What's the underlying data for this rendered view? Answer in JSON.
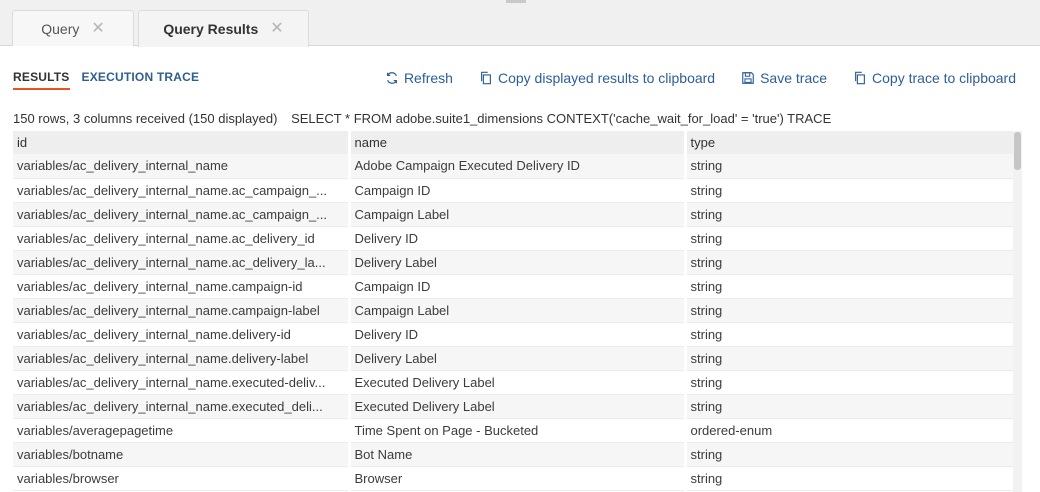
{
  "tabs": [
    {
      "label": "Query",
      "close": "✕"
    },
    {
      "label": "Query Results",
      "close": "✕"
    }
  ],
  "subtabs": [
    "RESULTS",
    "EXECUTION TRACE"
  ],
  "toolbar": {
    "refresh": "Refresh",
    "copy_results": "Copy displayed results to clipboard",
    "save_trace": "Save trace",
    "copy_trace": "Copy trace to clipboard"
  },
  "status": {
    "summary": "150 rows, 3 columns received (150 displayed)",
    "query": "SELECT * FROM adobe.suite1_dimensions CONTEXT('cache_wait_for_load' = 'true') TRACE"
  },
  "table": {
    "columns": [
      "id",
      "name",
      "type"
    ],
    "rows": [
      [
        "variables/ac_delivery_internal_name",
        "Adobe Campaign Executed Delivery ID",
        "string"
      ],
      [
        "variables/ac_delivery_internal_name.ac_campaign_...",
        "Campaign ID",
        "string"
      ],
      [
        "variables/ac_delivery_internal_name.ac_campaign_...",
        "Campaign Label",
        "string"
      ],
      [
        "variables/ac_delivery_internal_name.ac_delivery_id",
        "Delivery ID",
        "string"
      ],
      [
        "variables/ac_delivery_internal_name.ac_delivery_la...",
        "Delivery Label",
        "string"
      ],
      [
        "variables/ac_delivery_internal_name.campaign-id",
        "Campaign ID",
        "string"
      ],
      [
        "variables/ac_delivery_internal_name.campaign-label",
        "Campaign Label",
        "string"
      ],
      [
        "variables/ac_delivery_internal_name.delivery-id",
        "Delivery ID",
        "string"
      ],
      [
        "variables/ac_delivery_internal_name.delivery-label",
        "Delivery Label",
        "string"
      ],
      [
        "variables/ac_delivery_internal_name.executed-deliv...",
        "Executed Delivery Label",
        "string"
      ],
      [
        "variables/ac_delivery_internal_name.executed_deli...",
        "Executed Delivery Label",
        "string"
      ],
      [
        "variables/averagepagetime",
        "Time Spent on Page - Bucketed",
        "ordered-enum"
      ],
      [
        "variables/botname",
        "Bot Name",
        "string"
      ],
      [
        "variables/browser",
        "Browser",
        "string"
      ]
    ]
  },
  "colors": {
    "accent": "#e8541e",
    "link": "#2c5e99"
  },
  "icons": {
    "refresh": "refresh-icon",
    "copy": "copy-icon",
    "save": "save-icon"
  }
}
